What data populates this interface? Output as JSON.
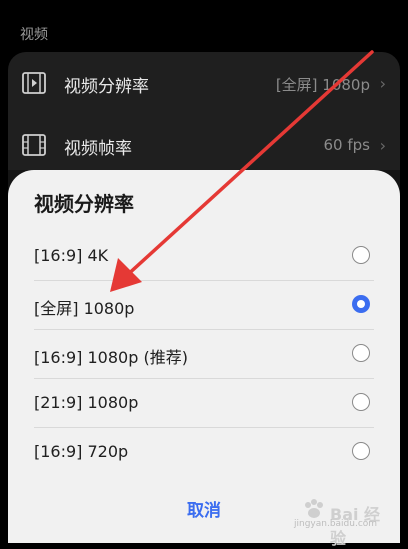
{
  "section": {
    "label": "视频"
  },
  "settings": [
    {
      "label": "视频分辨率",
      "value": "[全屏] 1080p",
      "icon": "video-file-icon"
    },
    {
      "label": "视频帧率",
      "value": "60 fps",
      "icon": "film-strip-icon"
    }
  ],
  "sheet": {
    "title": "视频分辨率",
    "options": [
      {
        "label": "[16:9] 4K",
        "selected": false
      },
      {
        "label": "[全屏] 1080p",
        "selected": true
      },
      {
        "label": "[16:9] 1080p (推荐)",
        "selected": false
      },
      {
        "label": "[21:9] 1080p",
        "selected": false
      },
      {
        "label": "[16:9] 720p",
        "selected": false
      }
    ],
    "cancel_label": "取消"
  },
  "colors": {
    "accent": "#3b6df0",
    "annotation_arrow": "#e53935"
  },
  "watermark": {
    "brand": "Bai 经验",
    "url": "jingyan.baidu.com"
  }
}
